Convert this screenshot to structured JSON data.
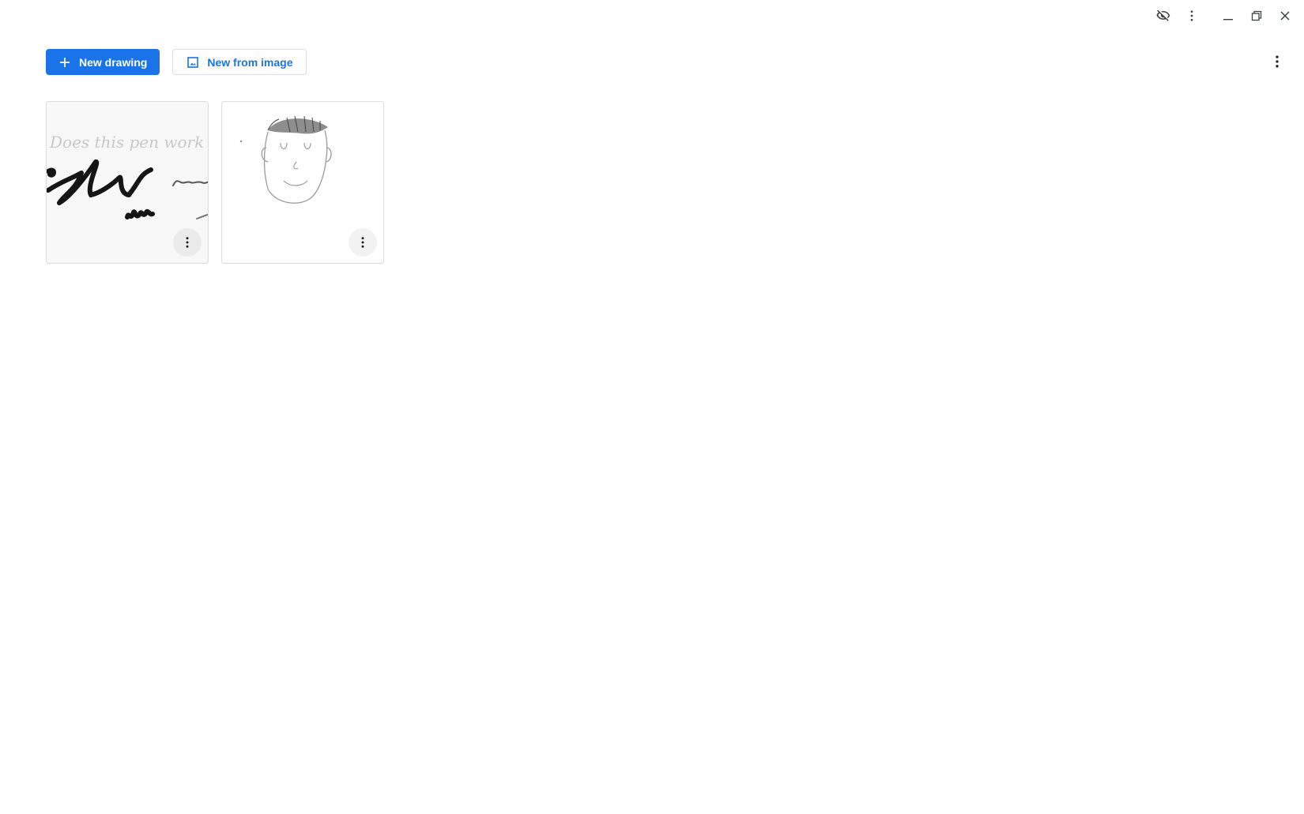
{
  "window": {
    "controls": [
      {
        "name": "privacy-icon",
        "icon": "eye-off-icon"
      },
      {
        "name": "window-menu",
        "icon": "more-vert-icon"
      },
      {
        "name": "minimize",
        "icon": "minimize-icon"
      },
      {
        "name": "restore",
        "icon": "restore-icon"
      },
      {
        "name": "close",
        "icon": "close-icon"
      }
    ]
  },
  "toolbar": {
    "new_drawing_label": "New drawing",
    "new_drawing_icon": "plus-icon",
    "new_from_image_label": "New from image",
    "new_from_image_icon": "image-icon",
    "more_icon": "more-vert-icon"
  },
  "drawings": [
    {
      "thumbnail": "handwriting-scribbles",
      "handwritten_text": "Does this pen work well?",
      "menu_icon": "more-vert-icon"
    },
    {
      "thumbnail": "face-sketch",
      "menu_icon": "more-vert-icon"
    }
  ],
  "colors": {
    "primary": "#1a73e8",
    "border": "#dadce0",
    "icon": "#3c4043"
  }
}
